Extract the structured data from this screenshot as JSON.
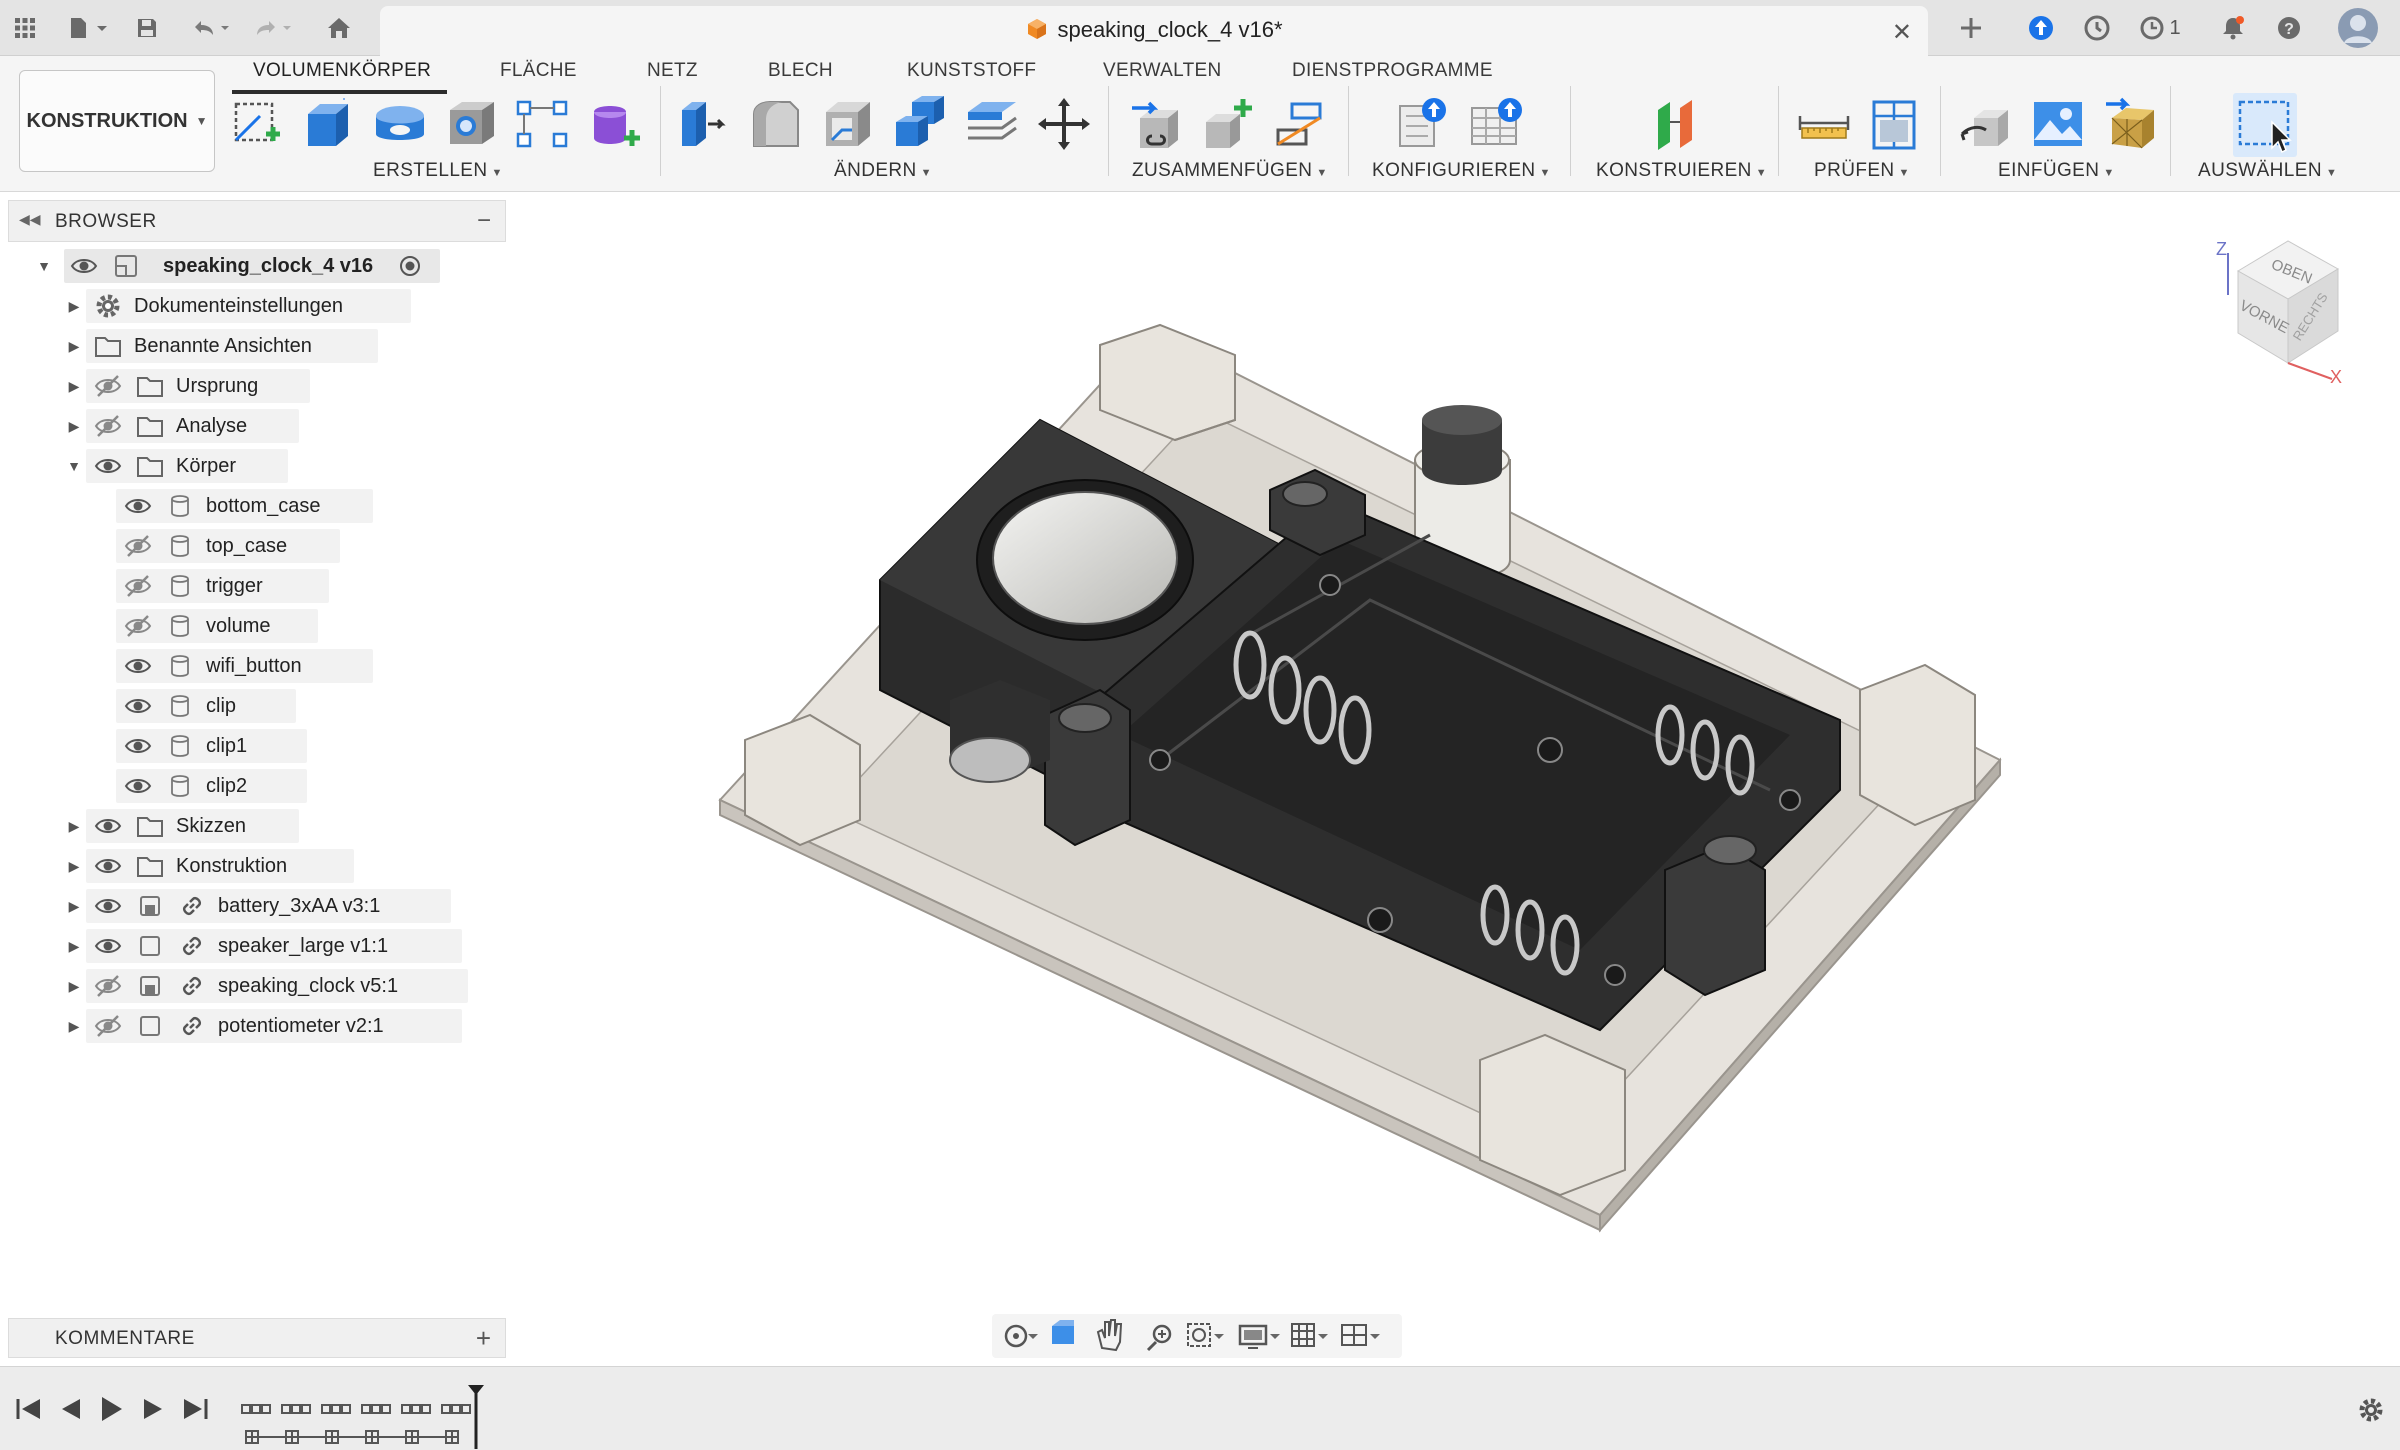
{
  "titlebar": {
    "document_title": "speaking_clock_4 v16*",
    "jobs_count": "1",
    "accent_color": "#1a73e8"
  },
  "ribbon": {
    "workspace": "KONSTRUKTION",
    "tabs": [
      "VOLUMENKÖRPER",
      "FLÄCHE",
      "NETZ",
      "BLECH",
      "KUNSTSTOFF",
      "VERWALTEN",
      "DIENSTPROGRAMME"
    ],
    "active_tab": "VOLUMENKÖRPER",
    "groups": [
      "ERSTELLEN",
      "ÄNDERN",
      "ZUSAMMENFÜGEN",
      "KONFIGURIEREN",
      "KONSTRUIEREN",
      "PRÜFEN",
      "EINFÜGEN",
      "AUSWÄHLEN"
    ]
  },
  "browser": {
    "title": "BROWSER",
    "root": "speaking_clock_4 v16",
    "items": [
      {
        "label": "Dokumenteinstellungen"
      },
      {
        "label": "Benannte Ansichten"
      },
      {
        "label": "Ursprung"
      },
      {
        "label": "Analyse"
      },
      {
        "label": "Körper"
      },
      {
        "label": "bottom_case"
      },
      {
        "label": "top_case"
      },
      {
        "label": "trigger"
      },
      {
        "label": "volume"
      },
      {
        "label": "wifi_button"
      },
      {
        "label": "clip"
      },
      {
        "label": "clip1"
      },
      {
        "label": "clip2"
      },
      {
        "label": "Skizzen"
      },
      {
        "label": "Konstruktion"
      },
      {
        "label": "battery_3xAA v3:1"
      },
      {
        "label": "speaker_large v1:1"
      },
      {
        "label": "speaking_clock v5:1"
      },
      {
        "label": "potentiometer v2:1"
      }
    ]
  },
  "viewcube": {
    "top": "OBEN",
    "front": "VORNE",
    "right": "RECHTS",
    "axis_z": "Z",
    "axis_x": "X"
  },
  "comments": {
    "title": "KOMMENTARE"
  }
}
